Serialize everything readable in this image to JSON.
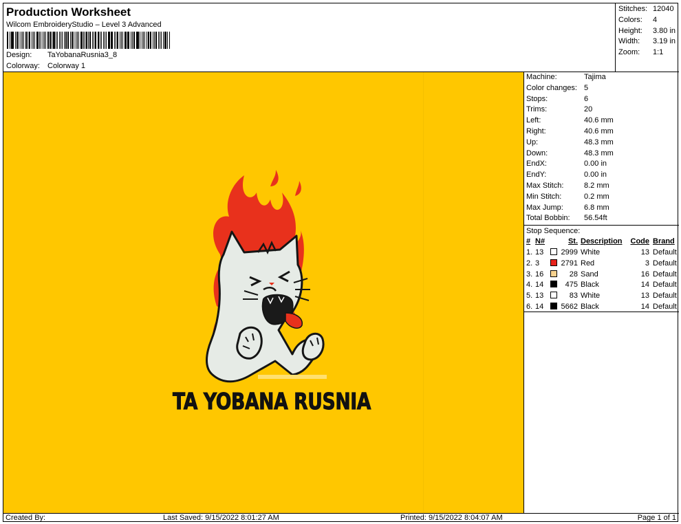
{
  "header": {
    "title": "Production Worksheet",
    "subtitle": "Wilcom EmbroideryStudio – Level 3 Advanced",
    "design_label": "Design:",
    "design_value": "TaYobanaRusnia3_8",
    "colorway_label": "Colorway:",
    "colorway_value": "Colorway 1"
  },
  "stats": [
    {
      "label": "Stitches:",
      "value": "12040"
    },
    {
      "label": "Colors:",
      "value": "4"
    },
    {
      "label": "Height:",
      "value": "3.80 in"
    },
    {
      "label": "Width:",
      "value": "3.19 in"
    },
    {
      "label": "Zoom:",
      "value": "1:1"
    }
  ],
  "machine_info": [
    {
      "label": "Machine:",
      "value": "Tajima"
    },
    {
      "label": "Color changes:",
      "value": "5"
    },
    {
      "label": "Stops:",
      "value": "6"
    },
    {
      "label": "Trims:",
      "value": "20"
    },
    {
      "label": "Left:",
      "value": "40.6 mm"
    },
    {
      "label": "Right:",
      "value": "40.6 mm"
    },
    {
      "label": "Up:",
      "value": "48.3 mm"
    },
    {
      "label": "Down:",
      "value": "48.3 mm"
    },
    {
      "label": "EndX:",
      "value": "0.00 in"
    },
    {
      "label": "EndY:",
      "value": "0.00 in"
    },
    {
      "label": "Max Stitch:",
      "value": "8.2 mm"
    },
    {
      "label": "Min Stitch:",
      "value": "0.2 mm"
    },
    {
      "label": "Max Jump:",
      "value": "6.8 mm"
    },
    {
      "label": "Total Bobbin:",
      "value": "56.54ft"
    }
  ],
  "stop_sequence": {
    "title": "Stop Sequence:",
    "headers": {
      "num": "#",
      "n": "N#",
      "st": "St.",
      "description": "Description",
      "code": "Code",
      "brand": "Brand"
    },
    "rows": [
      {
        "num": "1.",
        "n": "13",
        "color": "#ffffff",
        "st": "2999",
        "description": "White",
        "code": "13",
        "brand": "Default"
      },
      {
        "num": "2.",
        "n": "3",
        "color": "#e8231c",
        "st": "2791",
        "description": "Red",
        "code": "3",
        "brand": "Default"
      },
      {
        "num": "3.",
        "n": "16",
        "color": "#f7d28f",
        "st": "28",
        "description": "Sand",
        "code": "16",
        "brand": "Default"
      },
      {
        "num": "4.",
        "n": "14",
        "color": "#000000",
        "st": "475",
        "description": "Black",
        "code": "14",
        "brand": "Default"
      },
      {
        "num": "5.",
        "n": "13",
        "color": "#ffffff",
        "st": "83",
        "description": "White",
        "code": "13",
        "brand": "Default"
      },
      {
        "num": "6.",
        "n": "14",
        "color": "#000000",
        "st": "5662",
        "description": "Black",
        "code": "14",
        "brand": "Default"
      }
    ]
  },
  "canvas": {
    "background_color": "#ffc700",
    "design_text": "TA YOBANA RUSNIA"
  },
  "footer": {
    "created_by": "Created By:",
    "last_saved": "Last Saved: 9/15/2022 8:01:27 AM",
    "printed": "Printed: 9/15/2022 8:04:07 AM",
    "page": "Page 1 of 1"
  }
}
